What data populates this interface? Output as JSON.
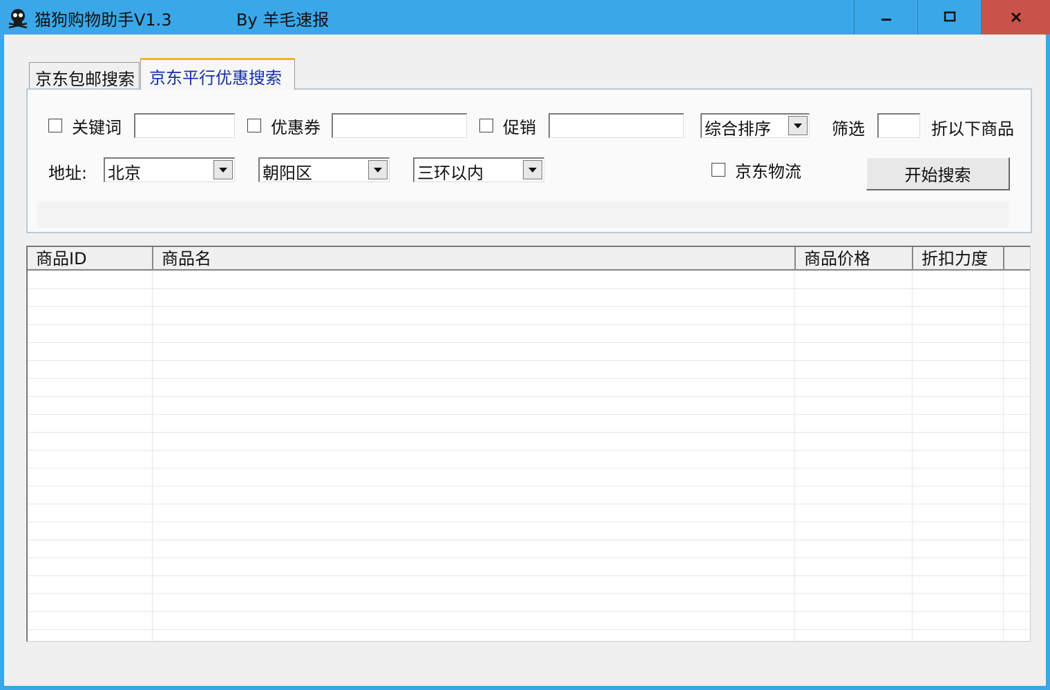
{
  "window": {
    "title": "猫狗购物助手V1.3",
    "byline": "By 羊毛速报",
    "controls": {
      "minimize": "minimize-icon",
      "maximize": "maximize-icon",
      "close": "close-icon"
    }
  },
  "tabs": [
    {
      "label": "京东包邮搜索"
    },
    {
      "label": "京东平行优惠搜索"
    }
  ],
  "filters": {
    "keyword_label": "关键词",
    "keyword_value": "",
    "coupon_label": "优惠券",
    "coupon_value": "",
    "promo_label": "促销",
    "promo_value": "",
    "sort_selected": "综合排序",
    "screen_label": "筛选",
    "discount_value": "",
    "discount_suffix": "折以下商品"
  },
  "address": {
    "label": "地址:",
    "city": "北京",
    "district": "朝阳区",
    "ring": "三环以内",
    "jd_logistics_label": "京东物流",
    "search_button": "开始搜索"
  },
  "table": {
    "columns": [
      "商品ID",
      "商品名",
      "商品价格",
      "折扣力度"
    ],
    "rows": []
  },
  "colors": {
    "titlebar": "#3aa8e8",
    "close": "#c9534b",
    "active_tab_text": "#1530a8",
    "tab_accent": "#f2b233"
  }
}
